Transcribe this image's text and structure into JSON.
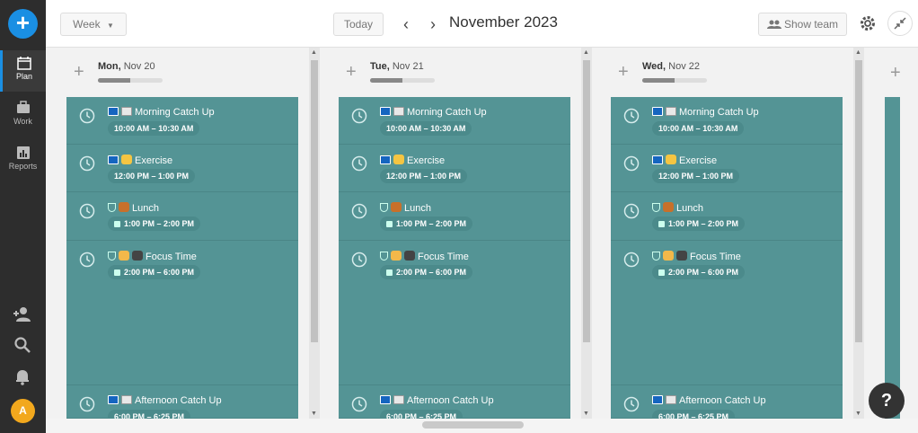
{
  "sidebar": {
    "fab": "+",
    "items": [
      {
        "label": "Plan",
        "icon": "calendar-icon"
      },
      {
        "label": "Work",
        "icon": "briefcase-icon"
      },
      {
        "label": "Reports",
        "icon": "bar-chart-icon"
      }
    ],
    "avatar_letter": "A"
  },
  "topbar": {
    "view": "Week",
    "today": "Today",
    "month": "November 2023",
    "show_team": "Show team"
  },
  "days": [
    {
      "weekday": "Mon,",
      "date": "Nov 20",
      "progress": 0.5
    },
    {
      "weekday": "Tue,",
      "date": "Nov 21",
      "progress": 0.5
    },
    {
      "weekday": "Wed,",
      "date": "Nov 22",
      "progress": 0.5
    }
  ],
  "events": [
    {
      "title": "Morning Catch Up",
      "time": "10:00 AM – 10:30 AM"
    },
    {
      "title": "Exercise",
      "time": "12:00 PM – 1:00 PM"
    },
    {
      "title": "Lunch",
      "time": "1:00 PM – 2:00 PM"
    },
    {
      "title": "Focus Time",
      "time": "2:00 PM – 6:00 PM"
    },
    {
      "title": "Afternoon Catch Up",
      "time": "6:00 PM – 6:25 PM"
    }
  ],
  "help": "?",
  "colors": {
    "accent": "#1a8fe3",
    "event": "#549495",
    "sidebar": "#2d2d2d"
  }
}
